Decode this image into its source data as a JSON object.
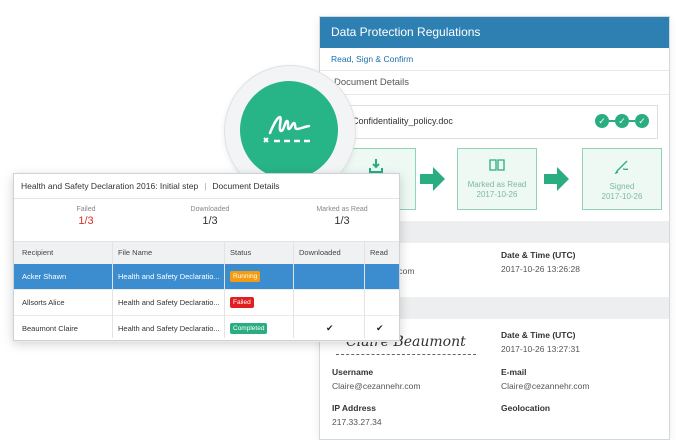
{
  "panel": {
    "title": "Data Protection Regulations",
    "subtitle": "Read, Sign & Confirm",
    "section": "Document Details",
    "file_name": "Confidentiality_policy.doc",
    "steps": [
      {
        "label": "",
        "date": "",
        "icon": "download-icon"
      },
      {
        "label": "Marked as Read",
        "date": "2017-10-26",
        "icon": "book-icon"
      },
      {
        "label": "Signed",
        "date": "2017-10-26",
        "icon": "pen-icon"
      }
    ],
    "block1": {
      "partial_value": ".com",
      "datetime_label": "Date & Time (UTC)",
      "datetime_value": "2017-10-26 13:26:28"
    },
    "block2": {
      "signature": "Claire Beaumont",
      "datetime_label": "Date & Time (UTC)",
      "datetime_value": "2017-10-26 13:27:31",
      "username_label": "Username",
      "username_value": "Claire@cezannehr.com",
      "email_label": "E-mail",
      "email_value": "Claire@cezannehr.com",
      "ip_label": "IP Address",
      "ip_value": "217.33.27.34",
      "geo_label": "Geolocation"
    },
    "colors": {
      "header": "#2e80b3",
      "accent": "#2aad80"
    }
  },
  "card": {
    "title": "Health and Safety Declaration 2016: Initial step",
    "title_tab": "Document Details",
    "stats": [
      {
        "label": "Failed",
        "value": "1/3"
      },
      {
        "label": "Downloaded",
        "value": "1/3"
      },
      {
        "label": "Marked as Read",
        "value": "1/3"
      }
    ],
    "columns": [
      "Recipient",
      "File Name",
      "Status",
      "Downloaded",
      "Read"
    ],
    "rows": [
      {
        "recipient": "Acker Shawn",
        "file": "Health and Safety Declaratio...",
        "status": "Running",
        "status_color": "#f39c12",
        "downloaded": "",
        "read": ""
      },
      {
        "recipient": "Allsorts Alice",
        "file": "Health and Safety Declaratio...",
        "status": "Failed",
        "status_color": "#e02020",
        "downloaded": "",
        "read": ""
      },
      {
        "recipient": "Beaumont Claire",
        "file": "Health and Safety Declaratio...",
        "status": "Completed",
        "status_color": "#2aad80",
        "downloaded": "✔",
        "read": "✔"
      }
    ]
  }
}
